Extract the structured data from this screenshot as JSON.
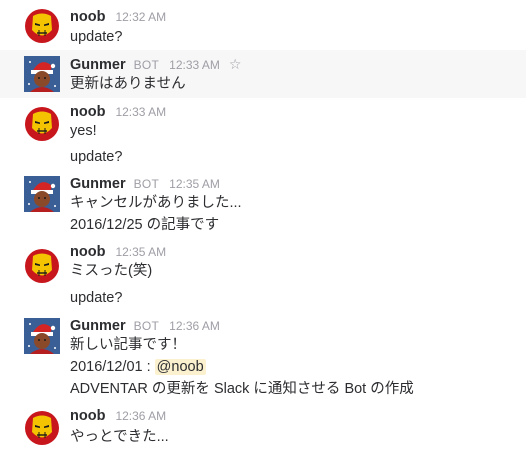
{
  "messages": [
    {
      "sender": "noob",
      "time": "12:32 AM",
      "lines": [
        "update?"
      ]
    },
    {
      "sender": "Gunmer",
      "bot": "BOT",
      "time": "12:33 AM",
      "lines": [
        "更新はありません"
      ]
    },
    {
      "sender": "noob",
      "time": "12:33 AM",
      "lines": [
        "yes!",
        "update?"
      ]
    },
    {
      "sender": "Gunmer",
      "bot": "BOT",
      "time": "12:35 AM",
      "lines": [
        "キャンセルがありました...",
        "2016/12/25 の記事です"
      ]
    },
    {
      "sender": "noob",
      "time": "12:35 AM",
      "lines": [
        "ミスった(笑)",
        "update?"
      ]
    },
    {
      "sender": "Gunmer",
      "bot": "BOT",
      "time": "12:36 AM",
      "lines": [
        "新しい記事です！",
        "2016/12/01 : ",
        "@noob",
        "ADVENTAR の更新を Slack に通知させる Bot の作成"
      ]
    },
    {
      "sender": "noob",
      "time": "12:36 AM",
      "lines": [
        "やっとできた..."
      ]
    }
  ],
  "icons": {
    "star": "star-outline-icon"
  },
  "colors": {
    "hover_bg": "#f7f7f7",
    "meta_text": "#9e9ea6",
    "mention_bg": "#fcf1cf",
    "ironman_red": "#c8161d",
    "ironman_gold": "#f5c400"
  }
}
